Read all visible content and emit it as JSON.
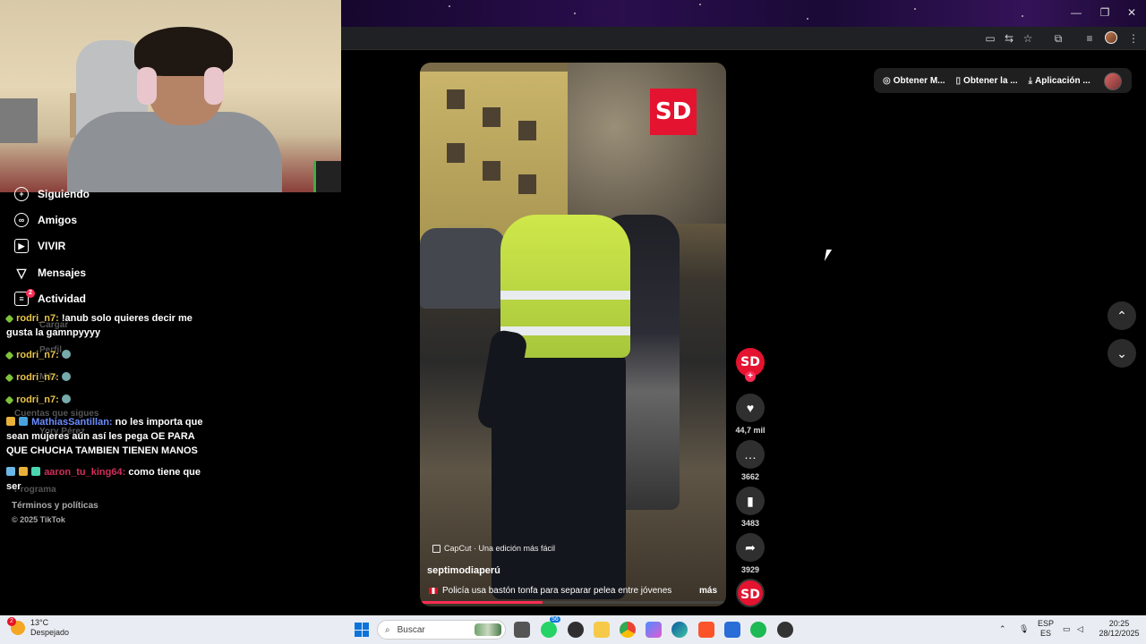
{
  "sidebar": {
    "items": [
      {
        "label": "Siguiendo",
        "icon": "following-icon"
      },
      {
        "label": "Amigos",
        "icon": "friends-icon"
      },
      {
        "label": "VIVIR",
        "icon": "live-icon"
      },
      {
        "label": "Mensajes",
        "icon": "messages-icon"
      },
      {
        "label": "Actividad",
        "icon": "activity-icon",
        "badge": "2"
      }
    ],
    "ghost_items": [
      "Cargar",
      "Perfil",
      "Más",
      "Cuentas que sigues",
      "Yory Pérez",
      "Programa"
    ],
    "footer": {
      "terms": "Términos y políticas",
      "copyright": "© 2025 TikTok"
    }
  },
  "chat": [
    {
      "user": "rodri_n7:",
      "text": "!anub solo quieres decir me gusta la gamnpyyyy",
      "color": "#e8c34a"
    },
    {
      "user": "rodri_n7:",
      "text": "",
      "color": "#e8c34a"
    },
    {
      "user": "rodri_n7:",
      "text": "",
      "color": "#e8c34a"
    },
    {
      "user": "rodri_n7:",
      "text": "",
      "color": "#e8c34a"
    },
    {
      "user": "MathiasSantillan:",
      "text": "no les importa que sean mujeres aún así les pega OE PARA QUE CHUCHA TAMBIEN TIENEN MANOS",
      "color": "#6b8cff"
    },
    {
      "user": "aaron_tu_king64:",
      "text": "como tiene que ser",
      "color": "#d0305a"
    }
  ],
  "header": {
    "pills": [
      "Obtener M...",
      "Obtener la ...",
      "Aplicación ..."
    ]
  },
  "video": {
    "logo": "SD",
    "capcut": "CapCut · Una edición más fácil",
    "author": "septimodiaperú",
    "description": "Policía usa bastón tonfa para separar pelea entre jóvenes",
    "more": "más",
    "progress": 0.4
  },
  "actions": {
    "avatar": "SD",
    "follow": "+",
    "likes": "44,7 mil",
    "comments": "3662",
    "saves": "3483",
    "shares": "3929",
    "music": "SD"
  },
  "taskbar": {
    "weather_temp": "13°C",
    "weather_desc": "Despejado",
    "weather_badge": "2",
    "search_placeholder": "Buscar",
    "lang": "ESP",
    "lang_sub": "ES",
    "time": "20:25",
    "date": "28/12/2025",
    "whatsapp_badge": "56"
  },
  "colors": {
    "accent": "#fe2c55",
    "brand_red": "#e4132f",
    "taskbar": "#e9edf3"
  }
}
